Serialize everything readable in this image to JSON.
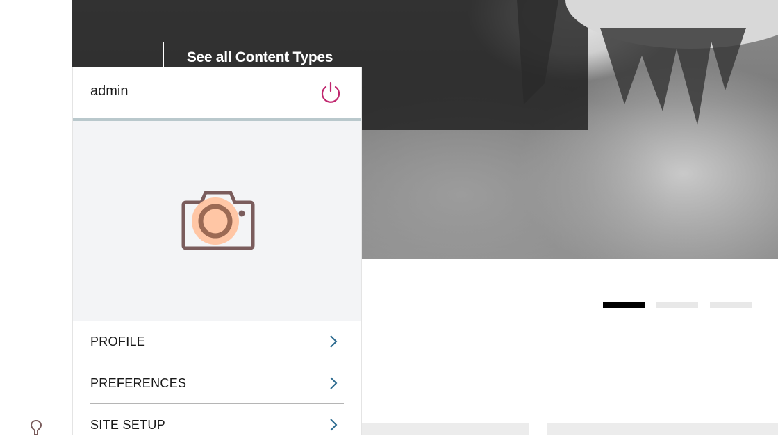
{
  "hero": {
    "button_label": "See all Content Types"
  },
  "carousel": {
    "slides": 3,
    "active_index": 0
  },
  "user_panel": {
    "username": "admin",
    "logout_icon": "power-icon",
    "avatar_icon": "camera-icon",
    "menu_items": [
      {
        "label": "PROFILE"
      },
      {
        "label": "PREFERENCES"
      },
      {
        "label": "SITE SETUP"
      }
    ]
  },
  "toolbar": {
    "icon": "location-pin-icon"
  },
  "colors": {
    "accent_power": "#c0266e",
    "chevron": "#2b6a8f",
    "camera_body": "#7a5c5c",
    "camera_lens": "#ffc3a0",
    "header_divider": "#b9c8cc"
  }
}
